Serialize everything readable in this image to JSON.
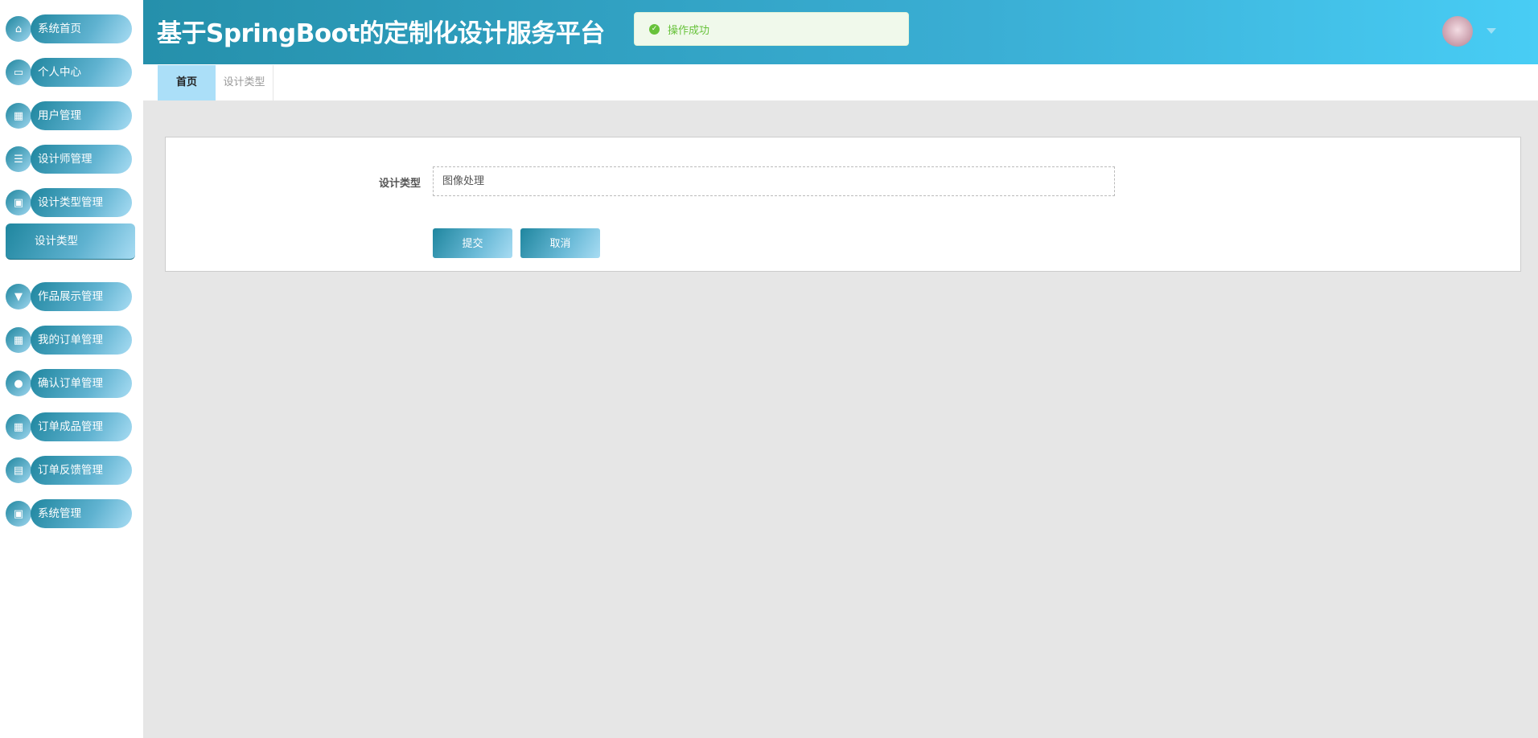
{
  "header": {
    "title": "基于SpringBoot的定制化设计服务平台",
    "toast": "操作成功",
    "toast_color": "#67c23a"
  },
  "sidebar": {
    "items": [
      {
        "label": "系统首页",
        "icon": "home-icon",
        "glyph": "⌂"
      },
      {
        "label": "个人中心",
        "icon": "wallet-icon",
        "glyph": "▭"
      },
      {
        "label": "用户管理",
        "icon": "grid-icon",
        "glyph": "▦"
      },
      {
        "label": "设计师管理",
        "icon": "list-icon",
        "glyph": "☰"
      },
      {
        "label": "设计类型管理",
        "icon": "clipboard-icon",
        "glyph": "▣"
      },
      {
        "label": "作品展示管理",
        "icon": "paint-brush-icon",
        "glyph": "▼"
      },
      {
        "label": "我的订单管理",
        "icon": "grid-icon",
        "glyph": "▦"
      },
      {
        "label": "确认订单管理",
        "icon": "lightbulb-icon",
        "glyph": "●"
      },
      {
        "label": "订单成品管理",
        "icon": "grid-icon",
        "glyph": "▦"
      },
      {
        "label": "订单反馈管理",
        "icon": "document-icon",
        "glyph": "▤"
      },
      {
        "label": "系统管理",
        "icon": "clipboard-check-icon",
        "glyph": "▣"
      }
    ],
    "sub_item": "设计类型"
  },
  "tabs": [
    {
      "label": "首页",
      "active": true
    },
    {
      "label": "设计类型",
      "active": false
    }
  ],
  "form": {
    "field_label": "设计类型",
    "field_value": "图像处理",
    "submit": "提交",
    "cancel": "取消"
  }
}
